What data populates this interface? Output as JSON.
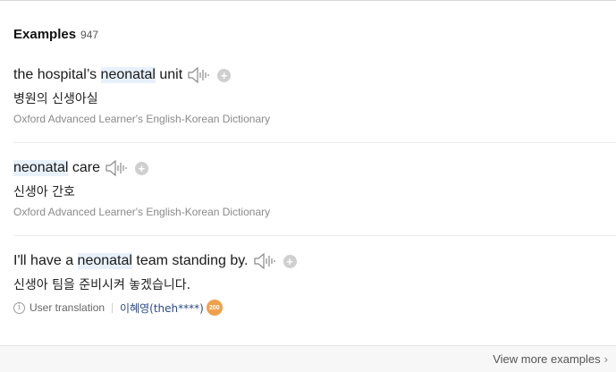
{
  "header": {
    "title": "Examples",
    "count": "947"
  },
  "examples": [
    {
      "en_pre": "the hospital’s ",
      "en_hl": "neonatal",
      "en_post": " unit",
      "ko": "병원의 신생아실",
      "source": "Oxford Advanced Learner's English-Korean Dictionary"
    },
    {
      "en_pre": "",
      "en_hl": "neonatal",
      "en_post": " care",
      "ko": "신생아 간호",
      "source": "Oxford Advanced Learner's English-Korean Dictionary"
    },
    {
      "en_pre": "I'll have a ",
      "en_hl": "neonatal",
      "en_post": " team standing by.",
      "ko": "신생아 팀을 준비시켜 놓겠습니다.",
      "user_translation_label": "User translation",
      "user_name": "이혜영(theh****)",
      "badge": "200"
    }
  ],
  "footer": {
    "view_more": "View more examples"
  },
  "icons": {
    "speaker": "speaker-icon",
    "plus": "plus-icon",
    "info": "info-icon",
    "chevron": "chevron-right-icon"
  }
}
